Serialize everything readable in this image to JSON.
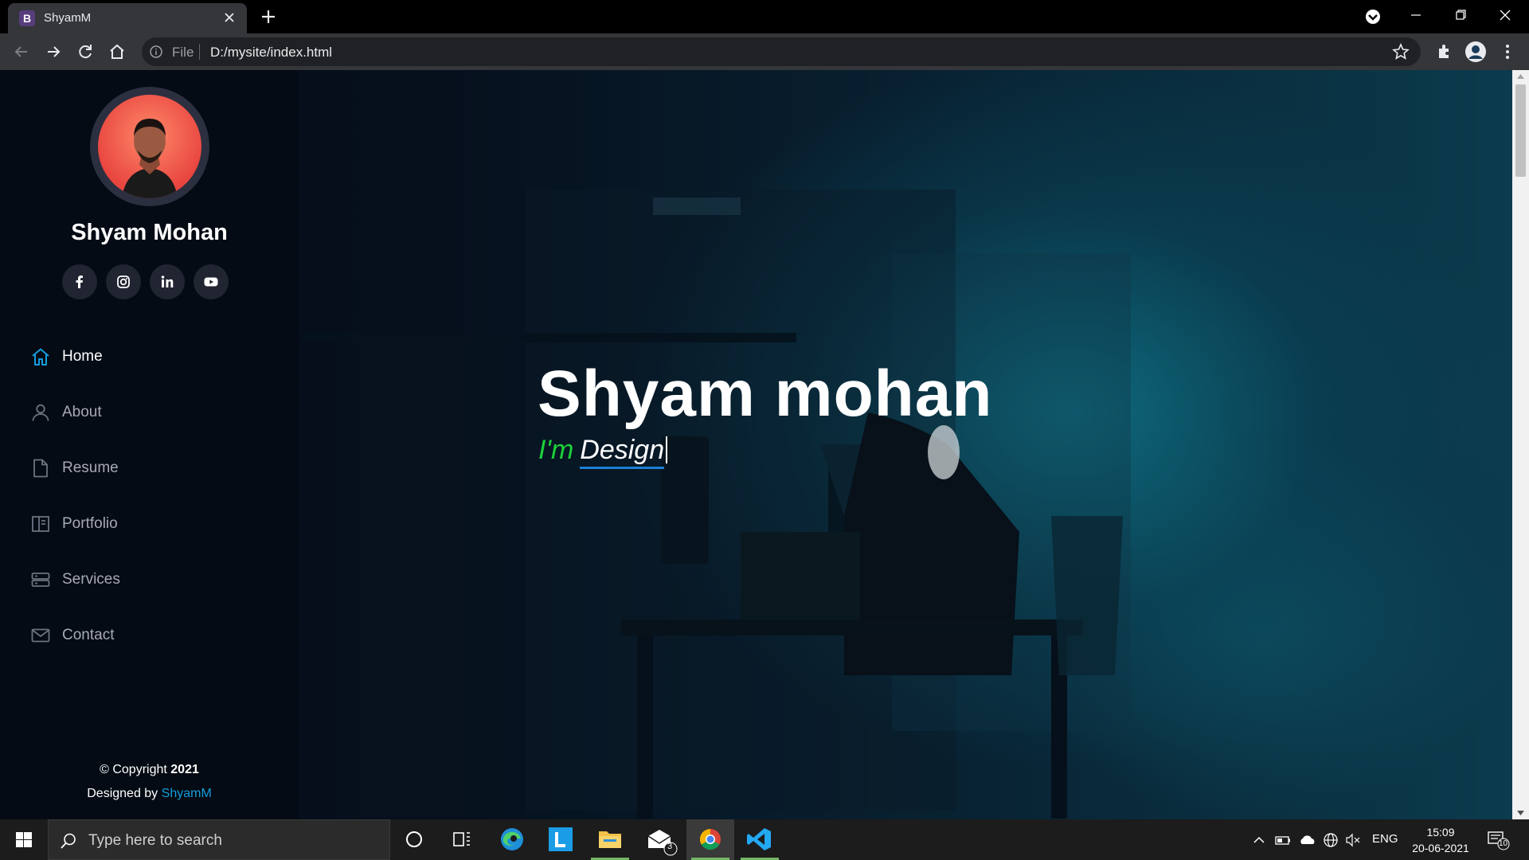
{
  "browser": {
    "tab_title": "ShyamM",
    "tab_favicon": "B",
    "url_scheme": "File",
    "url": "D:/mysite/index.html"
  },
  "sidebar": {
    "owner_name": "Shyam Mohan",
    "socials": [
      "facebook-icon",
      "instagram-icon",
      "linkedin-icon",
      "youtube-icon"
    ],
    "nav": [
      {
        "label": "Home",
        "icon": "home-icon",
        "active": true
      },
      {
        "label": "About",
        "icon": "user-icon"
      },
      {
        "label": "Resume",
        "icon": "file-icon"
      },
      {
        "label": "Portfolio",
        "icon": "book-icon"
      },
      {
        "label": "Services",
        "icon": "server-icon"
      },
      {
        "label": "Contact",
        "icon": "mail-icon"
      }
    ],
    "footer": {
      "copyright_prefix": "© Copyright",
      "year": "2021",
      "designed_by": "Designed by",
      "designer": "ShyamM"
    }
  },
  "hero": {
    "name": "Shyam mohan",
    "prefix": "I'm",
    "typed": "Design"
  },
  "taskbar": {
    "search_placeholder": "Type here to search",
    "mail_badge": "3",
    "language": "ENG",
    "time": "15:09",
    "date": "20-06-2021",
    "notifications": "10"
  },
  "colors": {
    "accent_blue": "#149ddd",
    "typed_green": "#1bd13a",
    "sidebar_bg": "#040b14"
  }
}
